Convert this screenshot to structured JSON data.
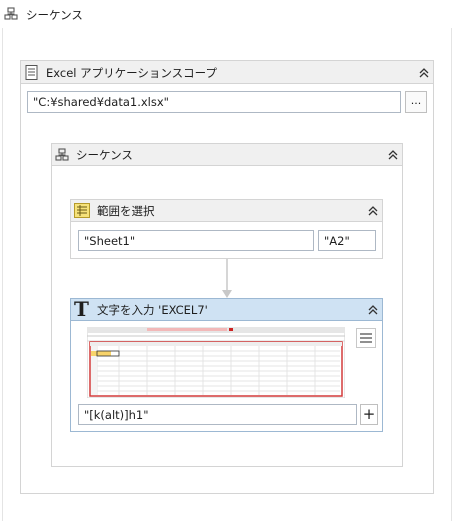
{
  "outer_sequence": {
    "title": "シーケンス",
    "icon": "sequence-icon"
  },
  "excel_scope": {
    "title": "Excel アプリケーションスコープ",
    "icon": "document-icon",
    "file_path": "\"C:¥shared¥data1.xlsx\"",
    "browse_label": "..."
  },
  "inner_sequence": {
    "title": "シーケンス",
    "icon": "sequence-icon"
  },
  "select_range": {
    "title": "範囲を選択",
    "icon": "range-select-icon",
    "sheet_value": "\"Sheet1\"",
    "cell_value": "\"A2\""
  },
  "type_into": {
    "title": "文字を入力 'EXCEL7'",
    "icon_glyph": "T",
    "input_value": "\"[k(alt)]h1\"",
    "add_label": "+",
    "accent_color": "#cfe2f3"
  }
}
